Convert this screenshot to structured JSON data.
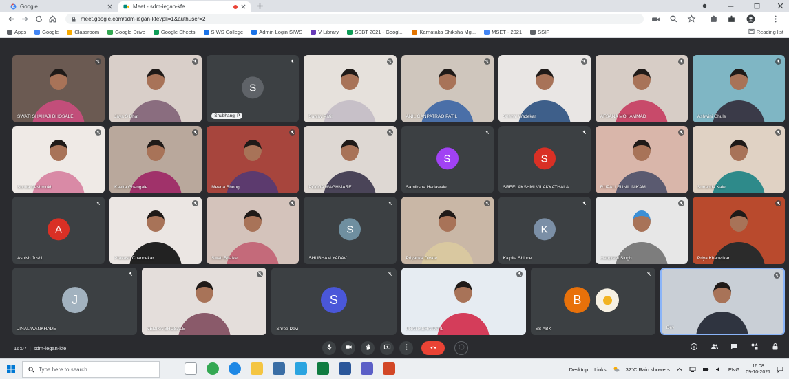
{
  "browser": {
    "tabs": [
      {
        "title": "Google",
        "icon": "google-icon"
      },
      {
        "title": "Meet - sdm-iegan-kfe",
        "icon": "meet-icon",
        "recording": true
      }
    ],
    "url": "meet.google.com/sdm-iegan-kfe?pli=1&authuser=2",
    "bookmarks": {
      "items": [
        "Apps",
        "Google",
        "Classroom",
        "Google Drive",
        "Google Sheets",
        "SIWS College",
        "Admin Login SIWS",
        "V Library",
        "SSBT 2021 - Googl...",
        "Karnataka Shiksha Mg...",
        "MSET - 2021",
        "SSIF"
      ],
      "colors": [
        "#5f6368",
        "#4285f4",
        "#f9ab00",
        "#34a853",
        "#0f9d58",
        "#1a73e8",
        "#1a73e8",
        "#673ab7",
        "#0f9d58",
        "#e37400",
        "#4285f4",
        "#5f6368"
      ],
      "reading_list": "Reading list"
    }
  },
  "meet": {
    "rows": [
      [
        {
          "name": "SWATI SHAHAJI BHOSALE",
          "bg": "#6b5a52",
          "shirt": "#c24e7a"
        },
        {
          "name": "Jaya S Bhat",
          "bg": "#d9cfc9",
          "shirt": "#8a6d7f"
        },
        {
          "name": "Shubhangi P",
          "initial": "S",
          "color": "#5f6368",
          "pill": true
        },
        {
          "name": "Sanjay Patil",
          "bg": "#e6e1dc",
          "shirt": "#c7c0c8"
        },
        {
          "name": "ANIL GANPATRAO PATIL",
          "bg": "#cfc6bd",
          "shirt": "#4a6fa8"
        },
        {
          "name": "Snehal Wadekar",
          "bg": "#e9e6e4",
          "shirt": "#3e5f8a"
        },
        {
          "name": "AFSANA MOHAMMAD",
          "bg": "#d7cdc6",
          "shirt": "#c84a6a"
        },
        {
          "name": "Ashwini Ghule",
          "bg": "#7fb6c4",
          "shirt": "#3a3a48"
        }
      ],
      [
        {
          "name": "Sunita Deshmukh",
          "bg": "#efeae6",
          "shirt": "#d98aa6"
        },
        {
          "name": "Kavita Ghangale",
          "bg": "#b9a89c",
          "shirt": "#a0326a"
        },
        {
          "name": "Meena Bhong",
          "bg": "#a7453d",
          "shirt": "#5c3a6e"
        },
        {
          "name": "POOJA WAGHMARE",
          "bg": "#ded8d3",
          "shirt": "#4a4458"
        },
        {
          "name": "Samiksha Hadawale",
          "initial": "S",
          "color": "#a142f4"
        },
        {
          "name": "SREELAKSHMI VILAKKATHALA",
          "initial": "S",
          "color": "#d93025"
        },
        {
          "name": "RUPALI SUNIL NIKAM",
          "bg": "#d9b6aa",
          "shirt": "#5a5a70"
        },
        {
          "name": "Sunanda Kale",
          "bg": "#e0d2c4",
          "shirt": "#2e8a8a"
        }
      ],
      [
        {
          "name": "Ashish Joshi",
          "initial": "A",
          "color": "#d93025"
        },
        {
          "name": "Prakash Chandekar",
          "bg": "#ebe6e3",
          "shirt": "#222222"
        },
        {
          "name": "Swati Bhalke",
          "bg": "#d4c3bb",
          "shirt": "#c46a7a"
        },
        {
          "name": "SHUBHAM YADAV",
          "initial": "S",
          "color": "#6f8fa0"
        },
        {
          "name": "Priyanka Divate",
          "bg": "#c9b7a6",
          "shirt": "#d9c8a0"
        },
        {
          "name": "Kalpita Shinde",
          "initial": "K",
          "color": "#7b8fa6"
        },
        {
          "name": "Manpreet Singh",
          "bg": "#e7e7e7",
          "shirt": "#7d7d7d",
          "hair": "#3b8fd6"
        },
        {
          "name": "Priya Khanvilkar",
          "bg": "#b94a2d",
          "shirt": "#2b2b2b"
        }
      ],
      [
        {
          "name": "JINAL WANKHADE",
          "initial": "J",
          "color": "#a2b2bf"
        },
        {
          "name": "VEDIKA BHOSALE",
          "bg": "#e4dedb",
          "shirt": "#8a5a6a"
        },
        {
          "name": "Shree Devi",
          "initial": "S",
          "color": "#4a57d9"
        },
        {
          "name": "PRATIKSHA PATIL",
          "bg": "#e6ecf2",
          "shirt": "#d43d5a"
        },
        {
          "name": "SS ABK",
          "initial": "B",
          "color": "#e8710a",
          "extra_icon": "fried-egg-icon"
        },
        {
          "name": "Dev",
          "bg": "#c9cfd6",
          "shirt": "#2f3440",
          "self": true
        }
      ]
    ],
    "meeting_time": "16:07",
    "separator": "|",
    "meeting_code": "sdm-iegan-kfe",
    "controls": [
      "microphone-icon",
      "camera-icon",
      "raise-hand-icon",
      "present-icon",
      "more-options-icon",
      "end-call-icon"
    ],
    "side_controls": [
      "info-icon",
      "people-icon",
      "chat-icon",
      "activities-icon",
      "host-controls-icon"
    ],
    "accent": "#8ab4f8",
    "end_call_color": "#ea4335"
  },
  "taskbar": {
    "search_placeholder": "Type here to search",
    "toolbars": [
      "Desktop",
      "Links"
    ],
    "weather": "32°C Rain showers",
    "language": "ENG",
    "time": "16:08",
    "date": "09-10-2021"
  }
}
